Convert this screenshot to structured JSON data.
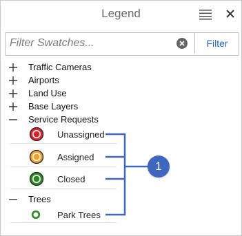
{
  "header": {
    "title": "Legend",
    "menu_icon": "hamburger-menu-icon",
    "close_icon": "close-icon"
  },
  "filter": {
    "placeholder": "Filter Swatches...",
    "value": "",
    "button_label": "Filter",
    "clear_icon": "clear-circle-icon"
  },
  "groups": [
    {
      "label": "Traffic Cameras",
      "state": "collapsed",
      "toggle": "+"
    },
    {
      "label": "Airports",
      "state": "collapsed",
      "toggle": "+"
    },
    {
      "label": "Land Use",
      "state": "collapsed",
      "toggle": "+"
    },
    {
      "label": "Base Layers",
      "state": "collapsed",
      "toggle": "+"
    },
    {
      "label": "Service Requests",
      "state": "expanded",
      "toggle": "−",
      "items": [
        {
          "label": "Unassigned",
          "color": "#e0232b"
        },
        {
          "label": "Assigned",
          "color": "#f2a126"
        },
        {
          "label": "Closed",
          "color": "#2c8a22"
        }
      ]
    },
    {
      "label": "Trees",
      "state": "expanded",
      "toggle": "−",
      "items": [
        {
          "label": "Park Trees",
          "color": "#2c8a22"
        }
      ]
    }
  ],
  "callout": {
    "badge": "1",
    "color": "#3f67c0"
  }
}
